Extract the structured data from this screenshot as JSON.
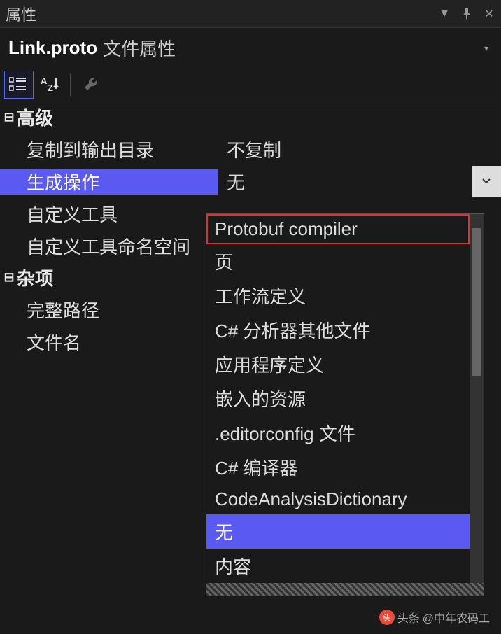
{
  "titlebar": {
    "title": "属性"
  },
  "subheader": {
    "filename": "Link.proto",
    "label": "文件属性"
  },
  "categories": [
    {
      "name": "高级",
      "rows": [
        {
          "label": "复制到输出目录",
          "value": "不复制"
        },
        {
          "label": "生成操作",
          "value": "无"
        },
        {
          "label": "自定义工具",
          "value": ""
        },
        {
          "label": "自定义工具命名空间",
          "value": ""
        }
      ]
    },
    {
      "name": "杂项",
      "rows": [
        {
          "label": "完整路径",
          "value": ""
        },
        {
          "label": "文件名",
          "value": ""
        }
      ]
    }
  ],
  "dropdown": {
    "items": [
      "Protobuf compiler",
      "页",
      "工作流定义",
      "C# 分析器其他文件",
      "应用程序定义",
      "嵌入的资源",
      ".editorconfig 文件",
      "C# 编译器",
      "CodeAnalysisDictionary",
      "无",
      "内容"
    ],
    "highlighted_index": 0,
    "selected_index": 9
  },
  "watermark": {
    "prefix": "头条",
    "author": "@中年农码工"
  }
}
